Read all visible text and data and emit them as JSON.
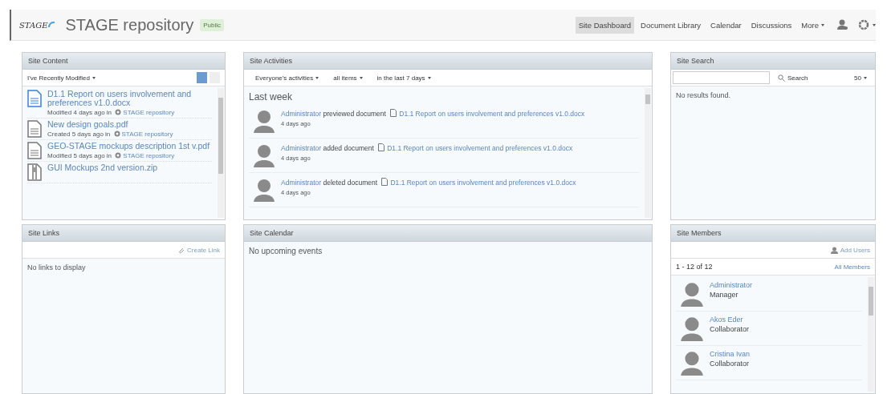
{
  "header": {
    "logo_text": "STAGE",
    "title": "STAGE repository",
    "visibility": "Public",
    "nav": [
      {
        "label": "Site Dashboard",
        "selected": true
      },
      {
        "label": "Document Library",
        "selected": false
      },
      {
        "label": "Calendar",
        "selected": false
      },
      {
        "label": "Discussions",
        "selected": false
      },
      {
        "label": "More",
        "selected": false
      }
    ]
  },
  "site_content": {
    "title": "Site Content",
    "filter": "I've Recently Modified",
    "views": [
      {
        "selected": true
      },
      {
        "selected": false
      }
    ],
    "items": [
      {
        "kind": "docx",
        "name": "D1.1 Report on users involvement and preferences v1.0.docx",
        "meta": "Modified 4 days ago in",
        "site": "STAGE repository"
      },
      {
        "kind": "file",
        "name": "New design goals.pdf",
        "meta": "Created 5 days ago in",
        "site": "STAGE repository"
      },
      {
        "kind": "file",
        "name": "GEO-STAGE mockups description 1st v.pdf",
        "meta": "Modified 5 days ago in",
        "site": "STAGE repository"
      },
      {
        "kind": "zip",
        "name": "GUI Mockups 2nd version.zip"
      }
    ]
  },
  "site_links": {
    "title": "Site Links",
    "action": "Create Link",
    "empty": "No links to display"
  },
  "site_activities": {
    "title": "Site Activities",
    "filters": [
      "Everyone's activities",
      "all items",
      "in the last 7 days"
    ],
    "group": "Last week",
    "entries": [
      {
        "user": "Administrator",
        "action": "previewed document",
        "document": "D1.1 Report on users involvement and preferences v1.0.docx",
        "time": "4 days ago"
      },
      {
        "user": "Administrator",
        "action": "added document",
        "document": "D1.1 Report on users involvement and preferences v1.0.docx",
        "time": "4 days ago"
      },
      {
        "user": "Administrator",
        "action": "deleted document",
        "document": "D1.1 Report on users involvement and preferences v1.0.docx",
        "time": "4 days ago"
      }
    ]
  },
  "site_calendar": {
    "title": "Site Calendar",
    "empty": "No upcoming events"
  },
  "site_search": {
    "title": "Site Search",
    "button": "Search",
    "page_size": "50",
    "empty": "No results found."
  },
  "site_members": {
    "title": "Site Members",
    "action": "Add Users",
    "count": "1 - 12 of 12",
    "all_link": "All Members",
    "members": [
      {
        "name": "Administrator",
        "role": "Manager"
      },
      {
        "name": "Akos Eder",
        "role": "Collaborator"
      },
      {
        "name": "Cristina Ivan",
        "role": "Collaborator"
      }
    ]
  }
}
